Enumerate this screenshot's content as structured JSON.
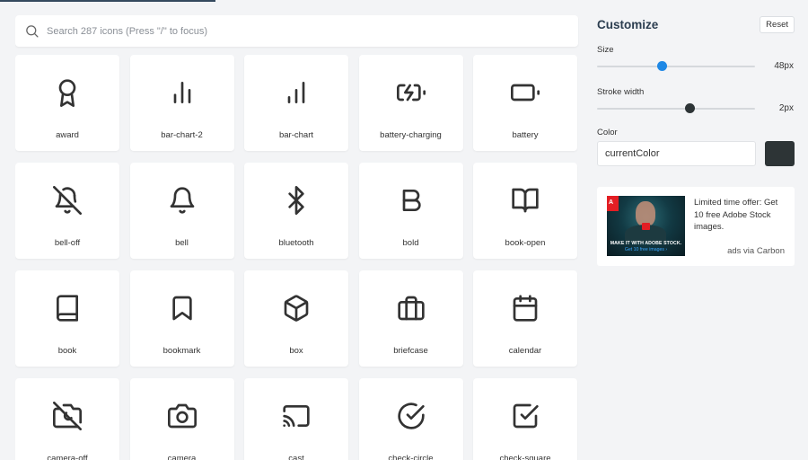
{
  "search": {
    "placeholder": "Search 287 icons (Press \"/\" to focus)"
  },
  "icons": [
    {
      "name": "award",
      "icon": "award-icon"
    },
    {
      "name": "bar-chart-2",
      "icon": "bar-chart-2-icon"
    },
    {
      "name": "bar-chart",
      "icon": "bar-chart-icon"
    },
    {
      "name": "battery-charging",
      "icon": "battery-charging-icon"
    },
    {
      "name": "battery",
      "icon": "battery-icon"
    },
    {
      "name": "bell-off",
      "icon": "bell-off-icon"
    },
    {
      "name": "bell",
      "icon": "bell-icon"
    },
    {
      "name": "bluetooth",
      "icon": "bluetooth-icon"
    },
    {
      "name": "bold",
      "icon": "bold-icon"
    },
    {
      "name": "book-open",
      "icon": "book-open-icon"
    },
    {
      "name": "book",
      "icon": "book-icon"
    },
    {
      "name": "bookmark",
      "icon": "bookmark-icon"
    },
    {
      "name": "box",
      "icon": "box-icon"
    },
    {
      "name": "briefcase",
      "icon": "briefcase-icon"
    },
    {
      "name": "calendar",
      "icon": "calendar-icon"
    },
    {
      "name": "camera-off",
      "icon": "camera-off-icon"
    },
    {
      "name": "camera",
      "icon": "camera-icon"
    },
    {
      "name": "cast",
      "icon": "cast-icon"
    },
    {
      "name": "check-circle",
      "icon": "check-circle-icon"
    },
    {
      "name": "check-square",
      "icon": "check-square-icon"
    }
  ],
  "customize": {
    "title": "Customize",
    "reset_label": "Reset",
    "size": {
      "label": "Size",
      "value_text": "48px",
      "fraction": 0.41
    },
    "stroke": {
      "label": "Stroke width",
      "value_text": "2px",
      "fraction": 0.59
    },
    "color": {
      "label": "Color",
      "value": "currentColor",
      "swatch": "#2d3436"
    }
  },
  "ad": {
    "text": "Limited time offer: Get 10 free Adobe Stock images.",
    "via": "ads via Carbon",
    "logo_text": "A",
    "image_headline": "MAKE IT WITH ADOBE STOCK.",
    "image_cta": "Get 10 free images ›"
  },
  "colors": {
    "accent": "#1e88e5",
    "thumb_dark": "#2d3436",
    "icon_stroke": "#333333"
  }
}
